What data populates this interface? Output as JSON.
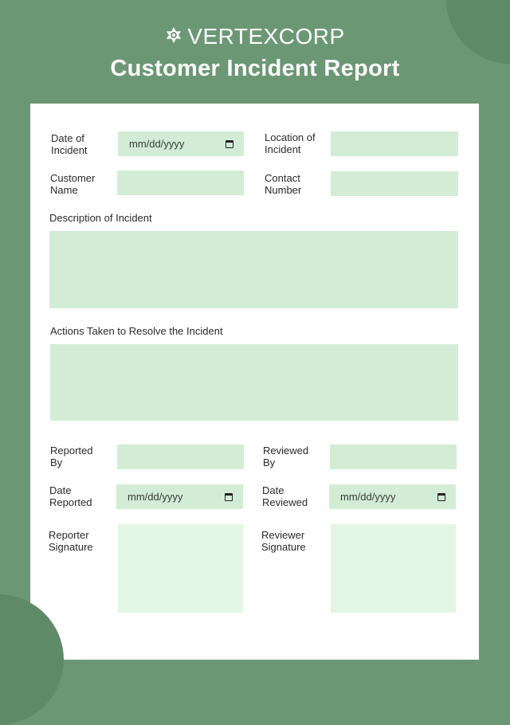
{
  "header": {
    "brand": "VERTEXCORP",
    "brand_icon": "star-hexagon-icon",
    "title": "Customer Incident Report"
  },
  "colors": {
    "background": "#6c9775",
    "accent_circle": "#5e8a67",
    "field": "#d3ecd6",
    "signature_field": "#e3f5e4"
  },
  "form": {
    "date_of_incident": {
      "label_1": "Date of",
      "label_2": "Incident",
      "placeholder": "mm/dd/yyyy"
    },
    "location_of_incident": {
      "label_1": "Location of",
      "label_2": "Incident",
      "value": ""
    },
    "customer_name": {
      "label_1": "Customer",
      "label_2": "Name",
      "value": ""
    },
    "contact_number": {
      "label_1": "Contact",
      "label_2": "Number",
      "value": ""
    },
    "description": {
      "label": "Description of Incident",
      "value": ""
    },
    "actions_taken": {
      "label": "Actions Taken to Resolve the Incident",
      "value": ""
    },
    "reported_by": {
      "label_1": "Reported",
      "label_2": "By",
      "value": ""
    },
    "reviewed_by": {
      "label_1": "Reviewed",
      "label_2": "By",
      "value": ""
    },
    "date_reported": {
      "label_1": "Date",
      "label_2": "Reported",
      "placeholder": "mm/dd/yyyy"
    },
    "date_reviewed": {
      "label_1": "Date",
      "label_2": "Reviewed",
      "placeholder": "mm/dd/yyyy"
    },
    "reporter_signature": {
      "label_1": "Reporter",
      "label_2": "Signature"
    },
    "reviewer_signature": {
      "label_1": "Reviewer",
      "label_2": "Signature"
    }
  }
}
